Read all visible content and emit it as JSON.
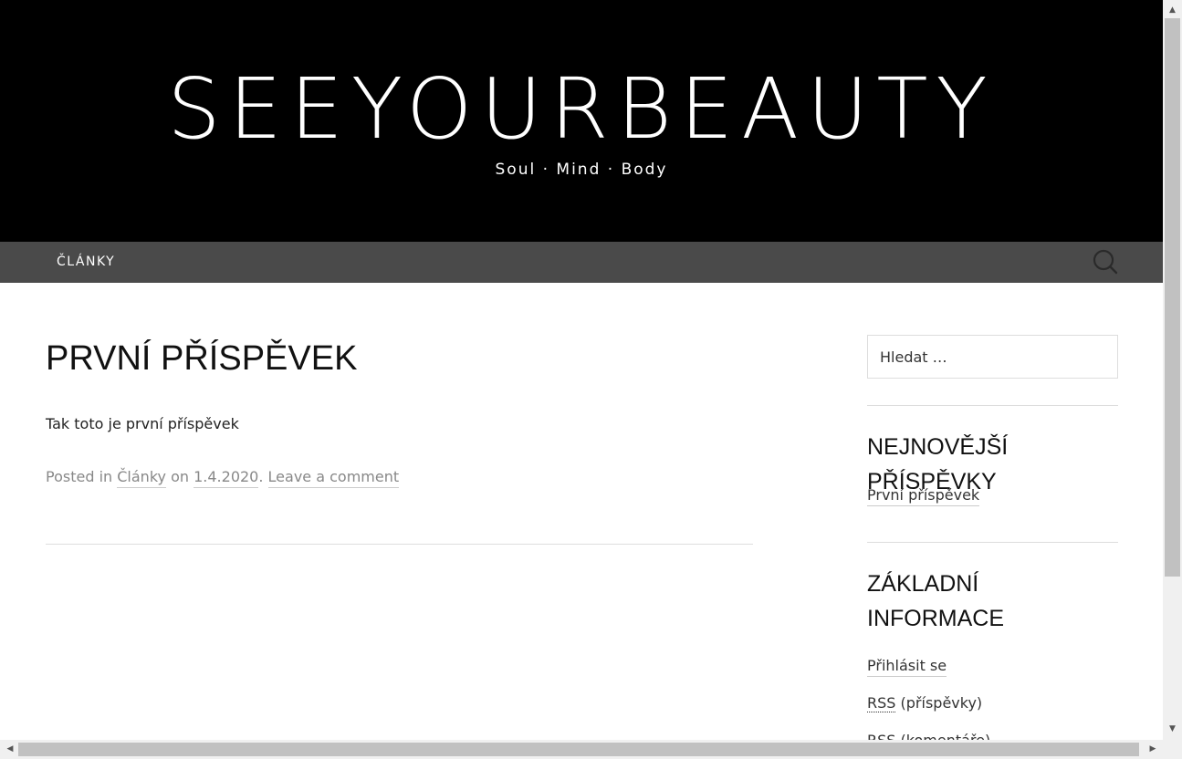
{
  "header": {
    "site_title": "SEEYOURBEAUTY",
    "tagline": "Soul · Mind · Body",
    "background": "#000000"
  },
  "nav": {
    "items": [
      {
        "label": "ČLÁNKY"
      }
    ],
    "search_icon": "search-icon",
    "background": "#4a4a4a"
  },
  "post": {
    "title": "PRVNÍ PŘÍSPĚVEK",
    "body": "Tak toto je první příspěvek",
    "meta": {
      "posted_in": "Posted in",
      "category": "Články",
      "on": "on",
      "date": "1.4.2020",
      "sep": ".",
      "comment_link": "Leave a comment"
    }
  },
  "sidebar": {
    "search": {
      "placeholder": "Hledat …"
    },
    "recent": {
      "title": "NEJNOVĚJŠÍ PŘÍSPĚVKY",
      "items": [
        "První příspěvek"
      ]
    },
    "meta": {
      "title_line1": "ZÁKLADNÍ",
      "title_line2": "INFORMACE",
      "login": "Přihlásit se",
      "rss_abbr": "RSS",
      "rss_posts": "(příspěvky)",
      "rss_comments": "(komentáře)"
    }
  },
  "scrollbars": {
    "up_arrow": "▲",
    "down_arrow": "▼",
    "left_arrow": "◀",
    "right_arrow": "▶"
  }
}
